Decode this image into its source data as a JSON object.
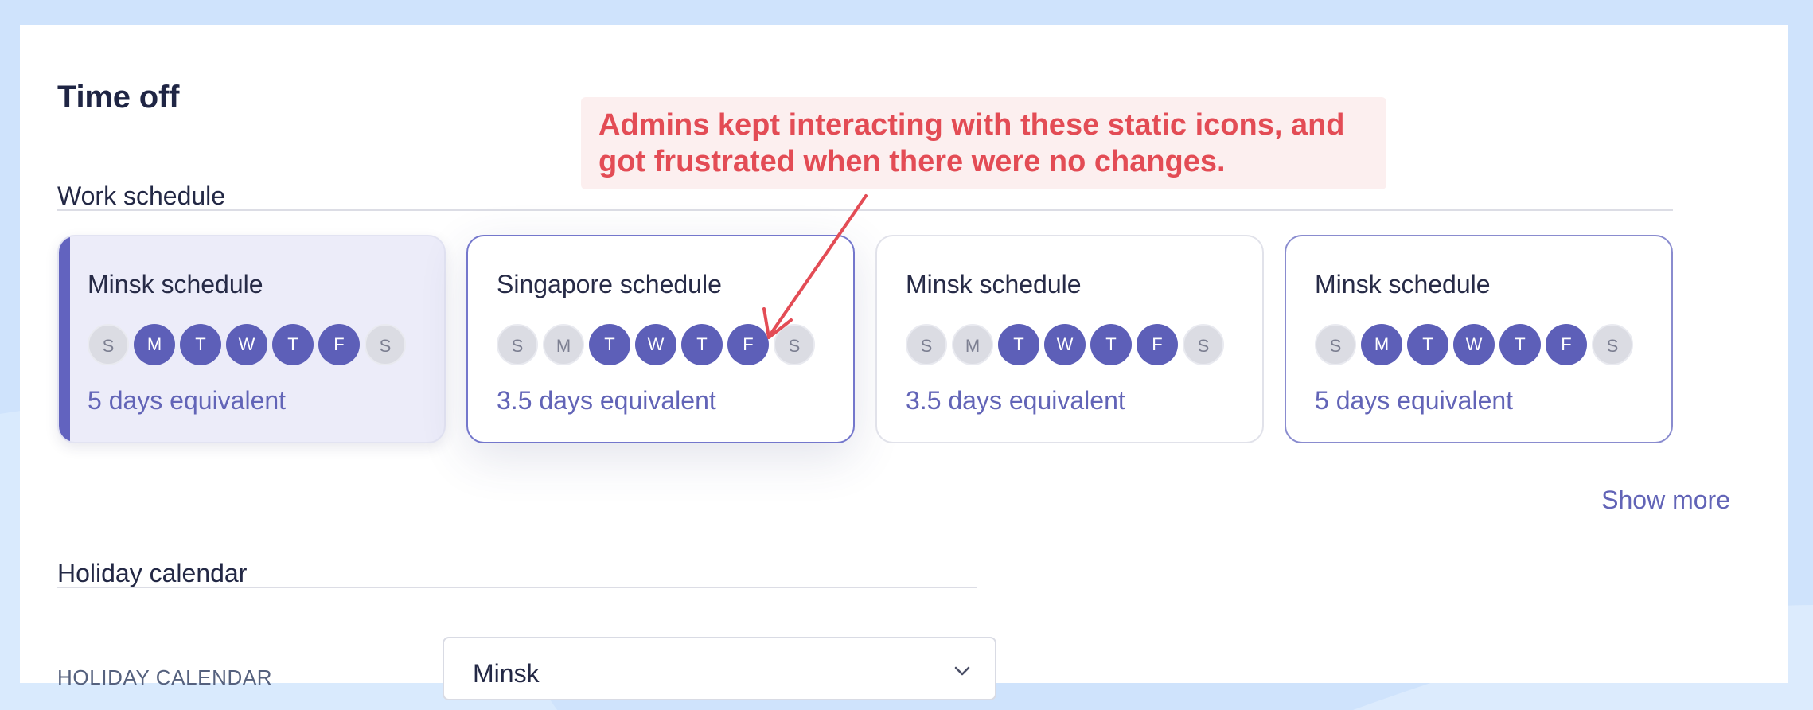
{
  "page": {
    "title": "Time off"
  },
  "work_schedule": {
    "heading": "Work schedule",
    "cards": [
      {
        "title": "Minsk schedule",
        "equivalent": "5 days equivalent",
        "state": "selected",
        "days": [
          {
            "letter": "S",
            "active": false
          },
          {
            "letter": "M",
            "active": true
          },
          {
            "letter": "T",
            "active": true
          },
          {
            "letter": "W",
            "active": true
          },
          {
            "letter": "T",
            "active": true
          },
          {
            "letter": "F",
            "active": true
          },
          {
            "letter": "S",
            "active": false
          }
        ]
      },
      {
        "title": "Singapore schedule",
        "equivalent": "3.5 days equivalent",
        "state": "hover",
        "days": [
          {
            "letter": "S",
            "active": false
          },
          {
            "letter": "M",
            "active": false
          },
          {
            "letter": "T",
            "active": true
          },
          {
            "letter": "W",
            "active": true
          },
          {
            "letter": "T",
            "active": true
          },
          {
            "letter": "F",
            "active": true
          },
          {
            "letter": "S",
            "active": false
          }
        ]
      },
      {
        "title": "Minsk schedule",
        "equivalent": "3.5 days equivalent",
        "state": "default",
        "days": [
          {
            "letter": "S",
            "active": false
          },
          {
            "letter": "M",
            "active": false
          },
          {
            "letter": "T",
            "active": true
          },
          {
            "letter": "W",
            "active": true
          },
          {
            "letter": "T",
            "active": true
          },
          {
            "letter": "F",
            "active": true
          },
          {
            "letter": "S",
            "active": false
          }
        ]
      },
      {
        "title": "Minsk schedule",
        "equivalent": "5 days equivalent",
        "state": "outlined",
        "days": [
          {
            "letter": "S",
            "active": false
          },
          {
            "letter": "M",
            "active": true
          },
          {
            "letter": "T",
            "active": true
          },
          {
            "letter": "W",
            "active": true
          },
          {
            "letter": "T",
            "active": true
          },
          {
            "letter": "F",
            "active": true
          },
          {
            "letter": "S",
            "active": false
          }
        ]
      }
    ],
    "show_more": "Show more"
  },
  "holiday_calendar": {
    "heading": "Holiday calendar",
    "field_label": "HOLIDAY CALENDAR",
    "selected_value": "Minsk"
  },
  "annotation": {
    "text": "Admins kept interacting with these static icons, and got frustrated when there were no changes."
  },
  "icons": {
    "select_chevron": "chevron-down-icon",
    "annotation_arrow": "arrow-icon"
  },
  "colors": {
    "accent": "#5d5fb8",
    "day_off": "#dbdce3",
    "link": "#6264b7",
    "annotation_text": "#e34c55",
    "annotation_bg": "#fcefef",
    "page_bg": "#cfe3fc"
  }
}
